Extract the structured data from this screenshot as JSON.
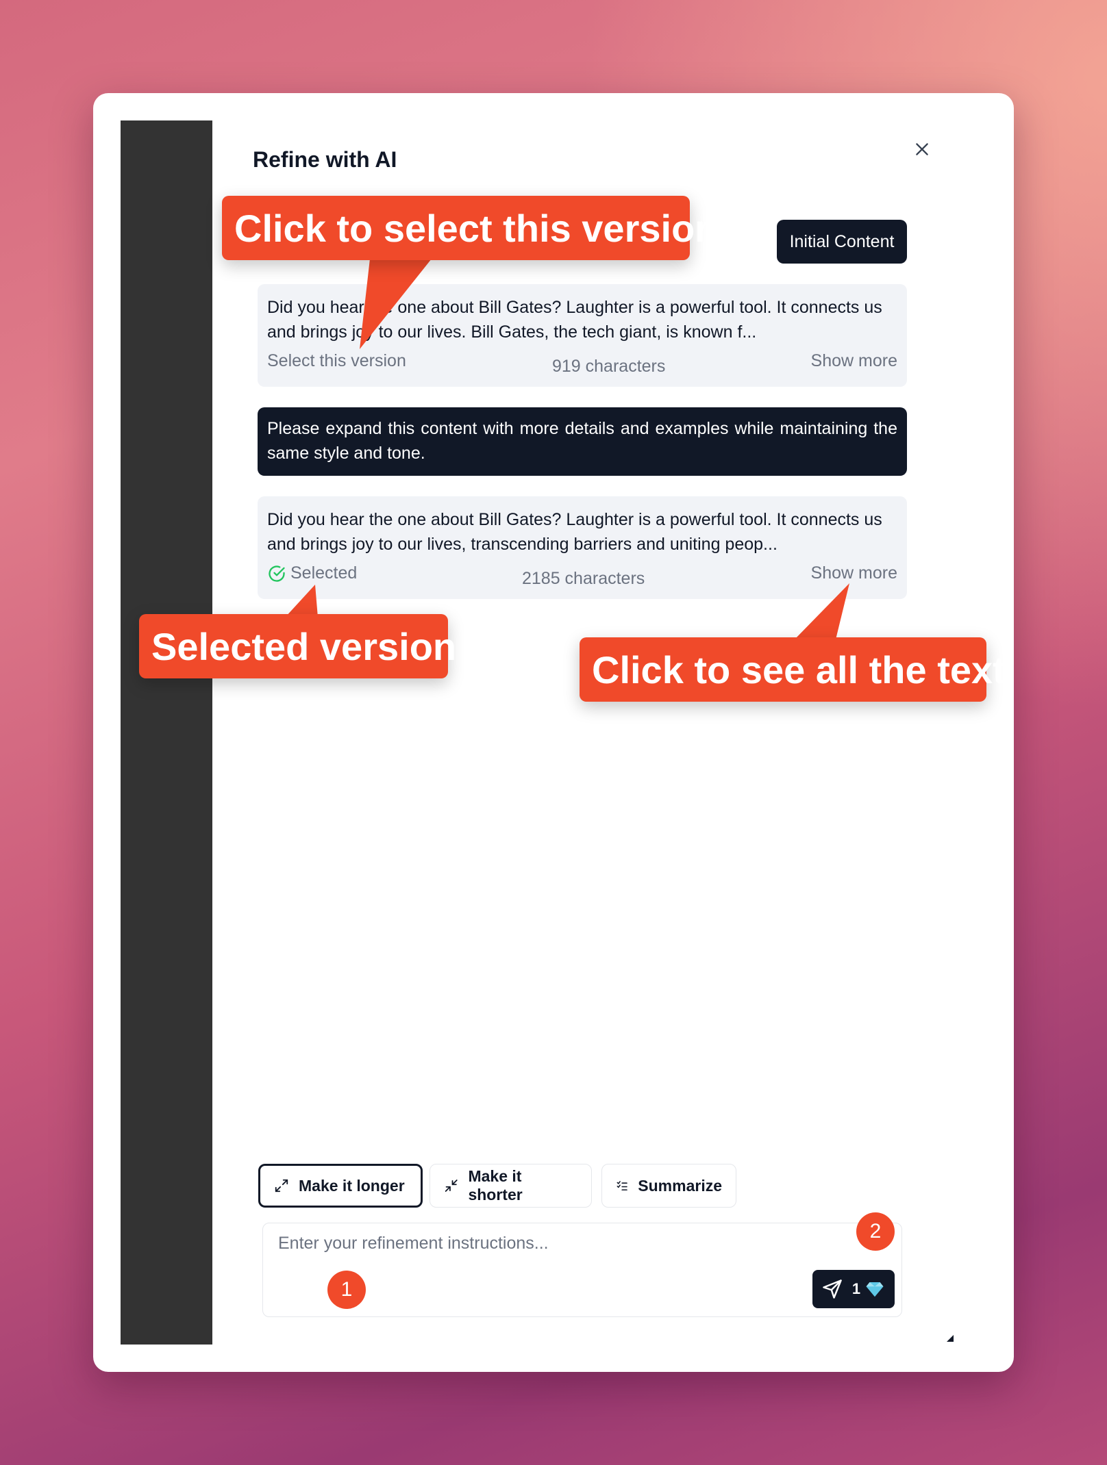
{
  "dialog": {
    "title": "Refine with AI",
    "close_icon": "close-icon",
    "initial_label": "Initial Content"
  },
  "versions": [
    {
      "text": "Did you hear the one about Bill Gates? Laughter is a powerful tool. It connects us and brings joy to our lives. Bill Gates, the tech giant, is known f...",
      "action": "Select this version",
      "chars": "919 characters",
      "show_more": "Show more"
    },
    {
      "text": "Did you hear the one about Bill Gates? Laughter is a powerful tool. It connects us and brings joy to our lives, transcending barriers and uniting peop...",
      "status": "Selected",
      "chars": "2185 characters",
      "show_more": "Show more"
    }
  ],
  "prompt": {
    "text": "Please expand this content with more details and examples while maintaining the same style and tone."
  },
  "actions": [
    {
      "label": "Make it longer",
      "icon": "expand-icon"
    },
    {
      "label": "Make it shorter",
      "icon": "shrink-icon"
    },
    {
      "label": "Summarize",
      "icon": "list-check-icon"
    }
  ],
  "input": {
    "placeholder": "Enter your refinement instructions...",
    "value": ""
  },
  "send": {
    "cost": "1",
    "icon": "send-icon",
    "currency_icon": "gem-icon"
  },
  "annotations": {
    "select_version": "Click to select this version",
    "selected_version": "Selected version",
    "see_all": "Click to see all the text",
    "badge_1": "1",
    "badge_2": "2"
  },
  "colors": {
    "accent": "#f04a2a",
    "dark": "#111827",
    "success": "#22c55e",
    "card_bg": "#f1f3f7"
  }
}
